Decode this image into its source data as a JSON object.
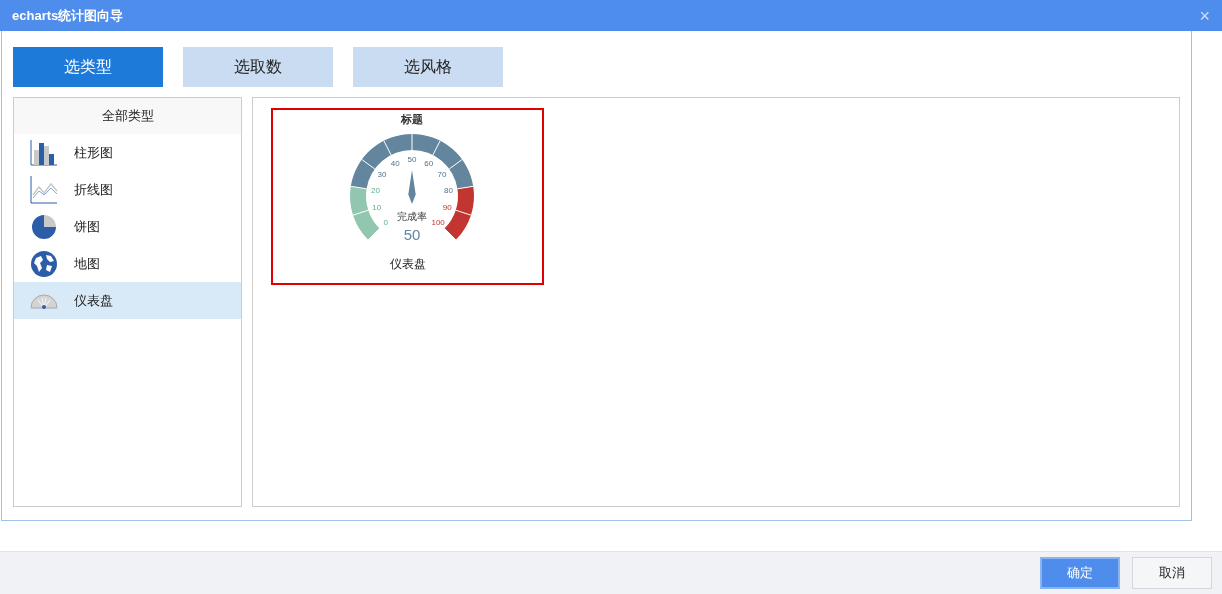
{
  "window": {
    "title": "echarts统计图向导",
    "close": "×"
  },
  "steps": [
    {
      "label": "选类型",
      "selected": true
    },
    {
      "label": "选取数",
      "selected": false
    },
    {
      "label": "选风格",
      "selected": false
    }
  ],
  "sidebar": {
    "header": "全部类型",
    "items": [
      {
        "label": "柱形图",
        "kind": "bar",
        "selected": false
      },
      {
        "label": "折线图",
        "kind": "line",
        "selected": false
      },
      {
        "label": "饼图",
        "kind": "pie",
        "selected": false
      },
      {
        "label": "地图",
        "kind": "map",
        "selected": false
      },
      {
        "label": "仪表盘",
        "kind": "gauge",
        "selected": true
      }
    ]
  },
  "previews": [
    {
      "caption": "仪表盘",
      "selected": true,
      "chart_title": "标题",
      "gauge_name": "完成率",
      "gauge_value": "50",
      "level": 0.5,
      "ticks": [
        "0",
        "10",
        "20",
        "30",
        "40",
        "50",
        "60",
        "70",
        "80",
        "90",
        "100"
      ]
    }
  ],
  "buttons": [
    {
      "label": "确定",
      "kind": "primary"
    },
    {
      "label": "取消",
      "kind": "secondary"
    }
  ]
}
